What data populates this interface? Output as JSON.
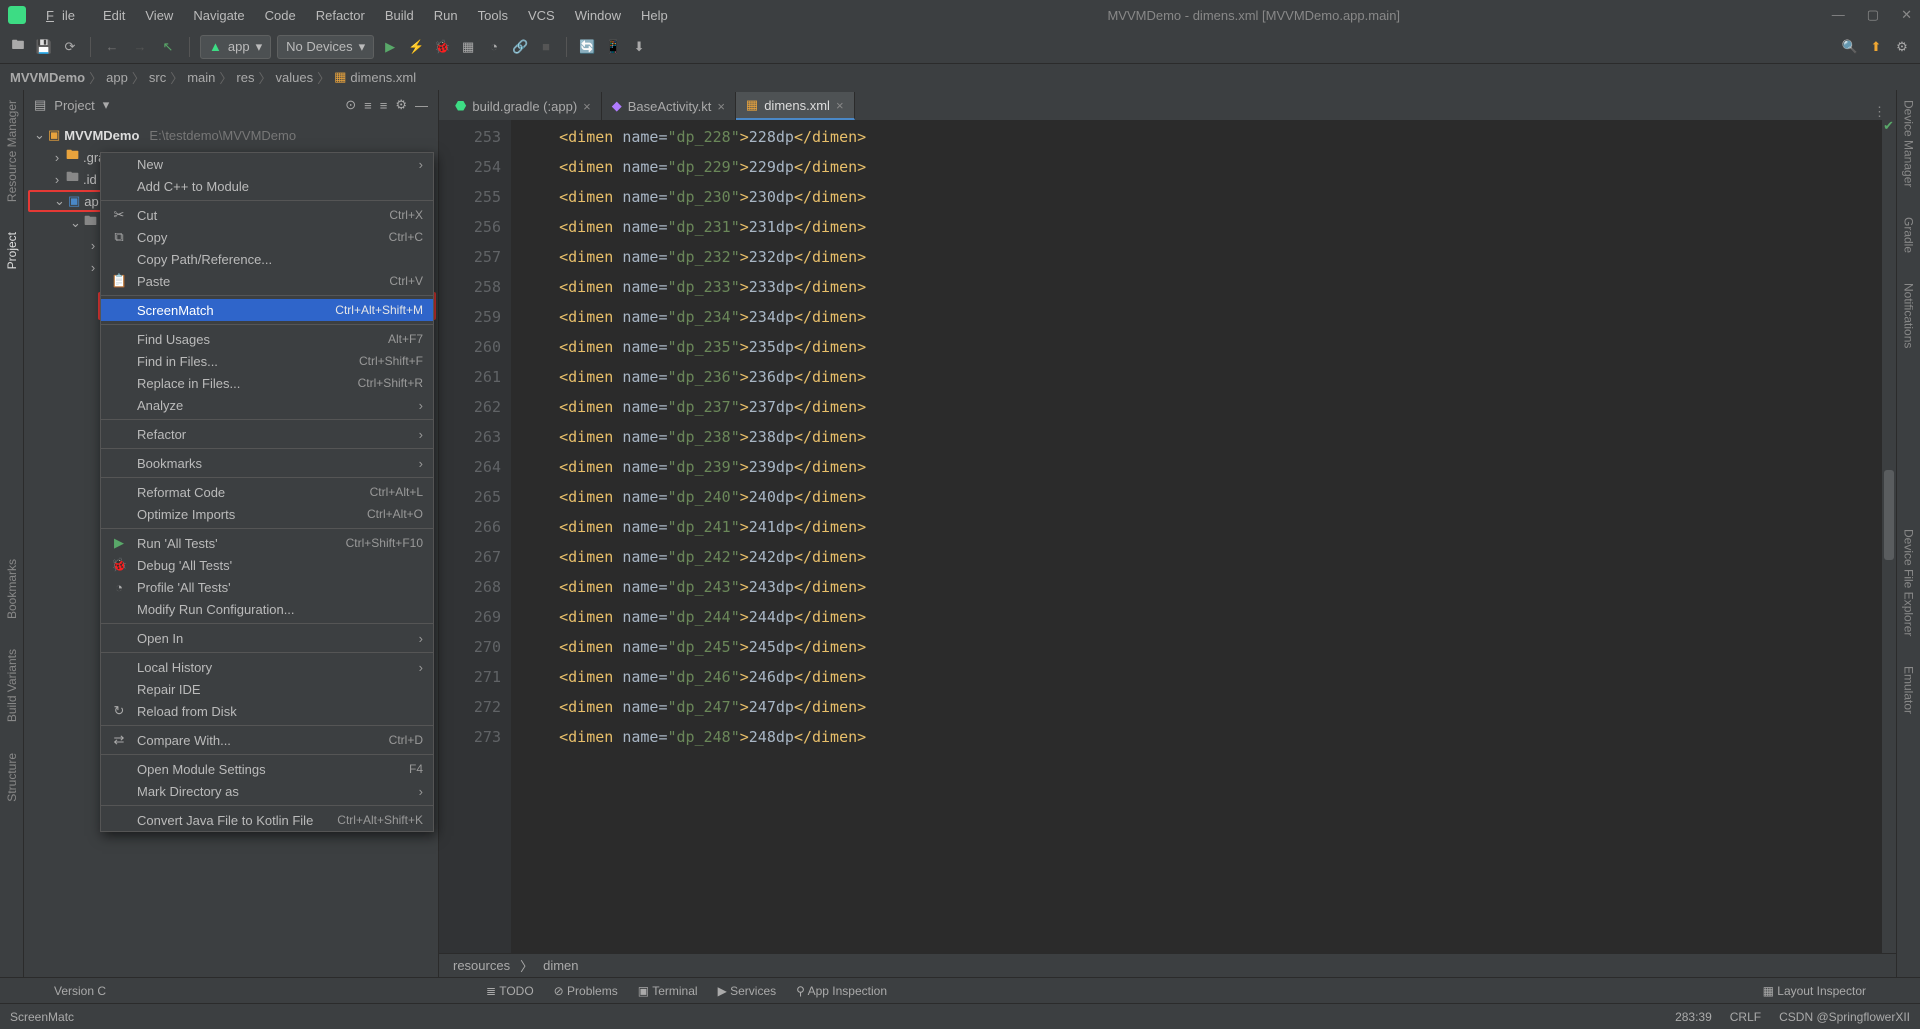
{
  "title": "MVVMDemo - dimens.xml [MVVMDemo.app.main]",
  "menu": {
    "file": "File",
    "edit": "Edit",
    "view": "View",
    "navigate": "Navigate",
    "code": "Code",
    "refactor": "Refactor",
    "build": "Build",
    "run": "Run",
    "tools": "Tools",
    "vcs": "VCS",
    "window": "Window",
    "help": "Help"
  },
  "toolbar": {
    "run_config": "app",
    "devices": "No Devices"
  },
  "breadcrumbs": [
    "MVVMDemo",
    "app",
    "src",
    "main",
    "res",
    "values",
    "dimens.xml"
  ],
  "project_header": "Project",
  "tree": {
    "root_name": "MVVMDemo",
    "root_path": "E:\\testdemo\\MVVMDemo",
    "c1": ".gradle",
    "c2": ".id",
    "c3": "ap"
  },
  "context_menu": [
    {
      "label": "New",
      "arrow": true
    },
    {
      "label": "Add C++ to Module"
    },
    {
      "sep": true
    },
    {
      "label": "Cut",
      "sc": "Ctrl+X",
      "ico": "✂"
    },
    {
      "label": "Copy",
      "sc": "Ctrl+C",
      "ico": "⧉"
    },
    {
      "label": "Copy Path/Reference..."
    },
    {
      "label": "Paste",
      "sc": "Ctrl+V",
      "ico": "📋"
    },
    {
      "sep": true
    },
    {
      "label": "ScreenMatch",
      "sc": "Ctrl+Alt+Shift+M",
      "hover": true
    },
    {
      "sep": true
    },
    {
      "label": "Find Usages",
      "sc": "Alt+F7"
    },
    {
      "label": "Find in Files...",
      "sc": "Ctrl+Shift+F"
    },
    {
      "label": "Replace in Files...",
      "sc": "Ctrl+Shift+R"
    },
    {
      "label": "Analyze",
      "arrow": true
    },
    {
      "sep": true
    },
    {
      "label": "Refactor",
      "arrow": true
    },
    {
      "sep": true
    },
    {
      "label": "Bookmarks",
      "arrow": true
    },
    {
      "sep": true
    },
    {
      "label": "Reformat Code",
      "sc": "Ctrl+Alt+L"
    },
    {
      "label": "Optimize Imports",
      "sc": "Ctrl+Alt+O"
    },
    {
      "sep": true
    },
    {
      "label": "Run 'All Tests'",
      "sc": "Ctrl+Shift+F10",
      "ico": "▶",
      "ico_color": "#59a869"
    },
    {
      "label": "Debug 'All Tests'",
      "ico": "🐞",
      "ico_color": "#59a869"
    },
    {
      "label": "Profile 'All Tests'",
      "ico": "◔"
    },
    {
      "label": "Modify Run Configuration..."
    },
    {
      "sep": true
    },
    {
      "label": "Open In",
      "arrow": true
    },
    {
      "sep": true
    },
    {
      "label": "Local History",
      "arrow": true
    },
    {
      "label": "Repair IDE"
    },
    {
      "label": "Reload from Disk",
      "ico": "↻"
    },
    {
      "sep": true
    },
    {
      "label": "Compare With...",
      "sc": "Ctrl+D",
      "ico": "⇄"
    },
    {
      "sep": true
    },
    {
      "label": "Open Module Settings",
      "sc": "F4"
    },
    {
      "label": "Mark Directory as",
      "arrow": true
    },
    {
      "sep": true
    },
    {
      "label": "Convert Java File to Kotlin File",
      "sc": "Ctrl+Alt+Shift+K"
    }
  ],
  "editor_tabs": [
    {
      "name": "build.gradle (:app)",
      "icon": "⬣",
      "icon_color": "#3ddc84",
      "close": true
    },
    {
      "name": "BaseActivity.kt",
      "icon": "◆",
      "icon_color": "#b07cff",
      "close": true
    },
    {
      "name": "dimens.xml",
      "icon": "▦",
      "icon_color": "#e8a33d",
      "close": true,
      "active": true
    }
  ],
  "code_lines": [
    {
      "n": 253,
      "name": "dp_228",
      "val": "228dp"
    },
    {
      "n": 254,
      "name": "dp_229",
      "val": "229dp"
    },
    {
      "n": 255,
      "name": "dp_230",
      "val": "230dp"
    },
    {
      "n": 256,
      "name": "dp_231",
      "val": "231dp"
    },
    {
      "n": 257,
      "name": "dp_232",
      "val": "232dp"
    },
    {
      "n": 258,
      "name": "dp_233",
      "val": "233dp"
    },
    {
      "n": 259,
      "name": "dp_234",
      "val": "234dp"
    },
    {
      "n": 260,
      "name": "dp_235",
      "val": "235dp"
    },
    {
      "n": 261,
      "name": "dp_236",
      "val": "236dp"
    },
    {
      "n": 262,
      "name": "dp_237",
      "val": "237dp"
    },
    {
      "n": 263,
      "name": "dp_238",
      "val": "238dp"
    },
    {
      "n": 264,
      "name": "dp_239",
      "val": "239dp"
    },
    {
      "n": 265,
      "name": "dp_240",
      "val": "240dp"
    },
    {
      "n": 266,
      "name": "dp_241",
      "val": "241dp"
    },
    {
      "n": 267,
      "name": "dp_242",
      "val": "242dp"
    },
    {
      "n": 268,
      "name": "dp_243",
      "val": "243dp"
    },
    {
      "n": 269,
      "name": "dp_244",
      "val": "244dp"
    },
    {
      "n": 270,
      "name": "dp_245",
      "val": "245dp"
    },
    {
      "n": 271,
      "name": "dp_246",
      "val": "246dp"
    },
    {
      "n": 272,
      "name": "dp_247",
      "val": "247dp"
    },
    {
      "n": 273,
      "name": "dp_248",
      "val": "248dp"
    }
  ],
  "editor_breadcrumb": [
    "resources",
    "dimen"
  ],
  "bottom_tabs": {
    "todo": "TODO",
    "problems": "Problems",
    "terminal": "Terminal",
    "services": "Services",
    "app_inspection": "App Inspection",
    "layout_inspector": "Layout Inspector"
  },
  "left_labels": {
    "resource_manager": "Resource Manager",
    "project": "Project",
    "bookmarks": "Bookmarks",
    "build_variants": "Build Variants",
    "structure": "Structure"
  },
  "right_labels": {
    "device_manager": "Device Manager",
    "gradle": "Gradle",
    "notifications": "Notifications",
    "device_file_explorer": "Device File Explorer",
    "emulator": "Emulator"
  },
  "statusbar": {
    "left": "ScreenMatc",
    "version": "Version C",
    "line_col": "283:39",
    "crlf": "CRLF",
    "watermark": "CSDN @SpringflowerXII"
  }
}
